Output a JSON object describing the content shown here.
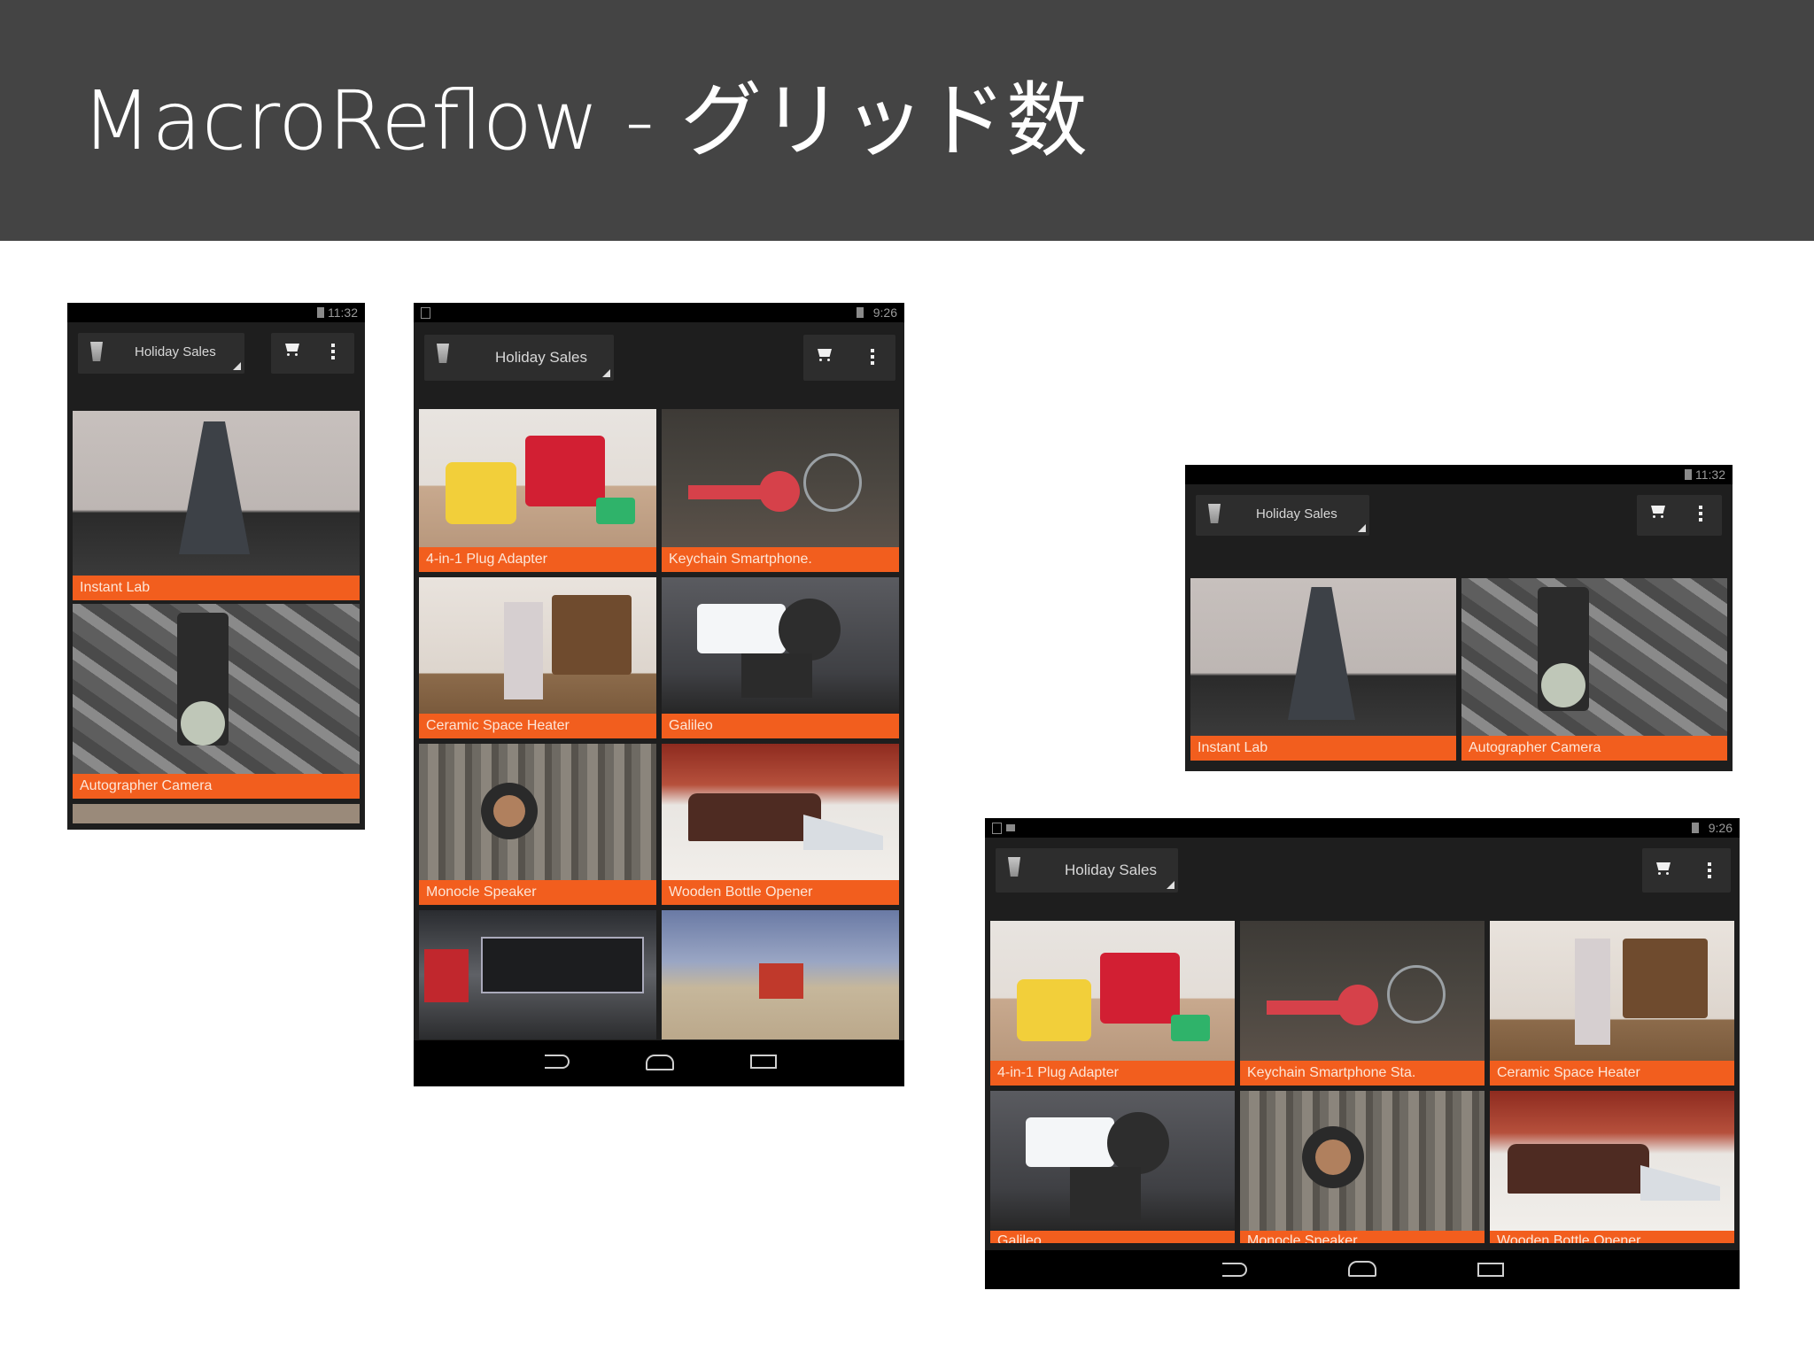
{
  "slide": {
    "title": "MacroReflow - グリッド数"
  },
  "phone_portrait_small": {
    "status_time": "11:32",
    "spinner_label": "Holiday Sales",
    "items": [
      "Instant Lab",
      "Autographer Camera"
    ]
  },
  "tablet_portrait": {
    "status_time": "9:26",
    "spinner_label": "Holiday Sales",
    "items": [
      "4-in-1 Plug Adapter",
      "Keychain Smartphone.",
      "Ceramic Space Heater",
      "Galileo",
      "Monocle Speaker",
      "Wooden Bottle Opener",
      "",
      ""
    ]
  },
  "phone_landscape": {
    "status_time": "11:32",
    "spinner_label": "Holiday Sales",
    "items": [
      "Instant Lab",
      "Autographer Camera"
    ]
  },
  "tablet_landscape": {
    "status_time": "9:26",
    "spinner_label": "Holiday Sales",
    "items": [
      "4-in-1 Plug Adapter",
      "Keychain Smartphone Sta.",
      "Ceramic Space Heater",
      "Galileo",
      "Monocle Speaker",
      "Wooden Bottle Opener"
    ]
  },
  "icons": {
    "app": "shopping-bag-icon",
    "cart": "cart-icon",
    "overflow": "overflow-menu-icon",
    "back": "back-icon",
    "home": "home-icon",
    "recents": "recents-icon"
  },
  "colors": {
    "header_bg": "#444444",
    "caption_bg": "#f25e1e",
    "app_bg": "#1e1e1e"
  }
}
